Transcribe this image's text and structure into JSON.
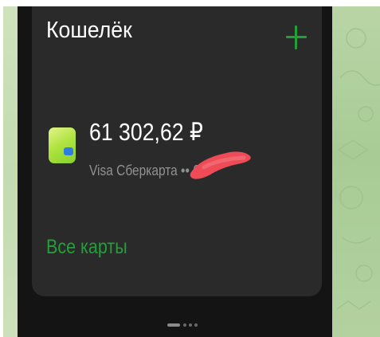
{
  "wallet": {
    "title": "Кошелёк",
    "add_icon": "plus-icon",
    "card": {
      "icon": "bank-card-icon",
      "balance": "61 302,62 ₽",
      "name": "Visa Сберкарта •• 6"
    },
    "all_cards_label": "Все карты"
  },
  "pager": {
    "pages": 4,
    "active_index": 0
  },
  "colors": {
    "background": "#141414",
    "card_background": "#2a2a2b",
    "accent": "#21a038",
    "text_primary": "#ffffff",
    "text_secondary": "#8f9091",
    "redaction": "#ee4b57",
    "wallpaper": "#b2d19f"
  }
}
